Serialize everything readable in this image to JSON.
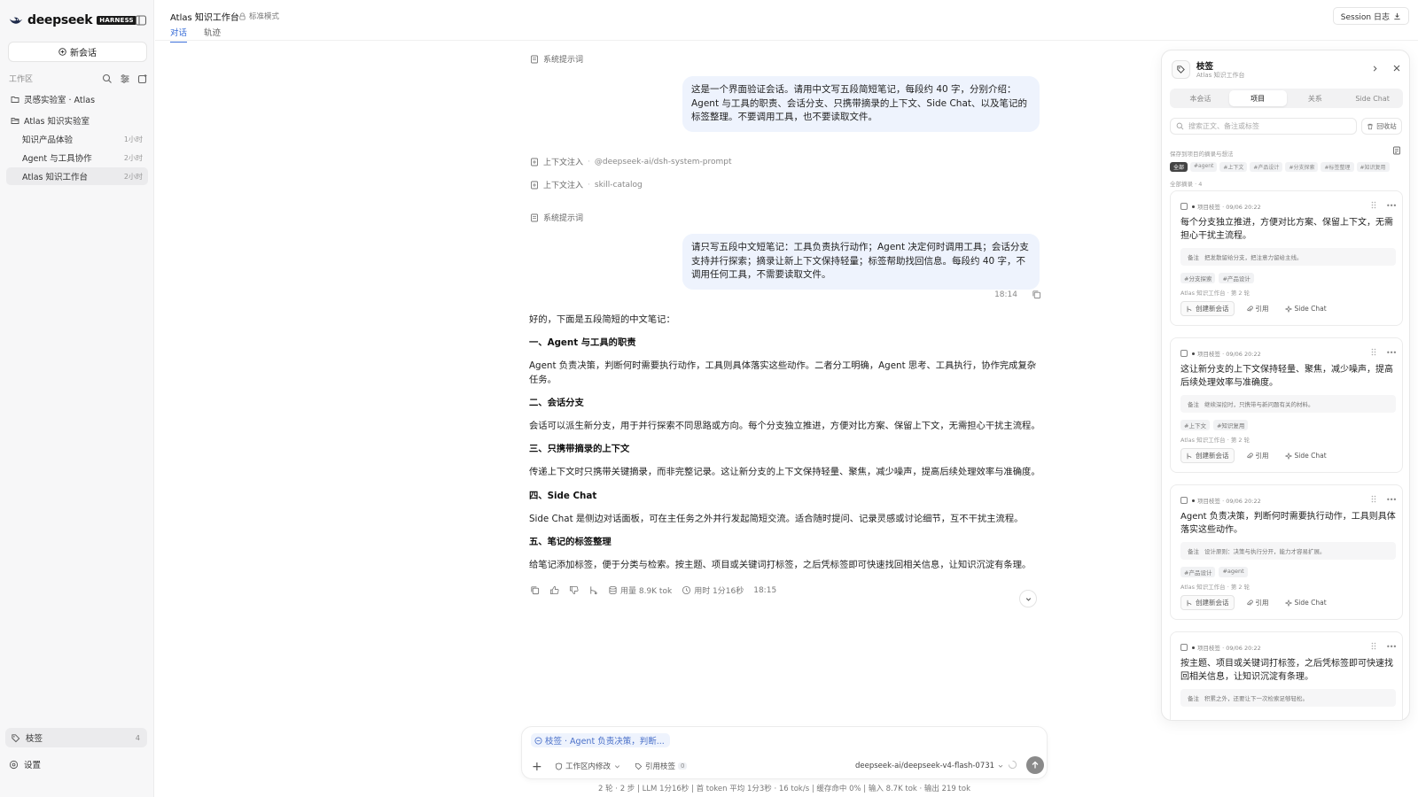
{
  "app": {
    "brand": "deepseek",
    "badge": "HARNESS"
  },
  "sidebar": {
    "new_chat": "新会话",
    "workspace_label": "工作区",
    "folders": [
      "灵感实验室 · Atlas",
      "Atlas 知识实验室"
    ],
    "conversations": [
      {
        "title": "知识产品体验",
        "time": "1小时"
      },
      {
        "title": "Agent 与工具协作",
        "time": "2小时"
      },
      {
        "title": "Atlas 知识工作台",
        "time": "2小时"
      }
    ],
    "tags_nav": {
      "label": "枝签",
      "count": "4"
    },
    "settings": "设置"
  },
  "topbar": {
    "title": "Atlas 知识工作台",
    "mode": "标准模式",
    "tabs": [
      "对话",
      "轨迹"
    ],
    "session_log": "Session 日志"
  },
  "chat": {
    "system_prompt_label": "系统提示词",
    "user_msg_1": "这是一个界面验证会话。请用中文写五段简短笔记，每段约 40 字，分别介绍：Agent 与工具的职责、会话分支、只携带摘录的上下文、Side Chat、以及笔记的标签整理。不要调用工具，也不要读取文件。",
    "context_injections": [
      {
        "label": "上下文注入",
        "value": "@deepseek-ai/dsh-system-prompt"
      },
      {
        "label": "上下文注入",
        "value": "skill-catalog"
      }
    ],
    "user_msg_2": "请只写五段中文短笔记：工具负责执行动作；Agent 决定何时调用工具；会话分支支持并行探索；摘录让新上下文保持轻量；标签帮助找回信息。每段约 40 字，不调用任何工具，不需要读取文件。",
    "user_msg_2_time": "18:14",
    "answer": {
      "intro": "好的，下面是五段简短的中文笔记：",
      "sections": [
        {
          "heading": "一、Agent 与工具的职责",
          "body": "Agent 负责决策，判断何时需要执行动作，工具则具体落实这些动作。二者分工明确，Agent 思考、工具执行，协作完成复杂任务。"
        },
        {
          "heading": "二、会话分支",
          "body": "会话可以派生新分支，用于并行探索不同思路或方向。每个分支独立推进，方便对比方案、保留上下文，无需担心干扰主流程。"
        },
        {
          "heading": "三、只携带摘录的上下文",
          "body": "传递上下文时只携带关键摘录，而非完整记录。这让新分支的上下文保持轻量、聚焦，减少噪声，提高后续处理效率与准确度。"
        },
        {
          "heading": "四、Side Chat",
          "body": "Side Chat 是侧边对话面板，可在主任务之外并行发起简短交流。适合随时提问、记录灵感或讨论细节，互不干扰主流程。"
        },
        {
          "heading": "五、笔记的标签整理",
          "body": "给笔记添加标签，便于分类与检索。按主题、项目或关键词打标签，之后凭标签即可快速找回相关信息，让知识沉淀有条理。"
        }
      ]
    },
    "stats": {
      "usage": "用量 8.9K tok",
      "elapsed": "用时 1分16秒",
      "time": "18:15"
    }
  },
  "composer": {
    "ref_chip": "枝签 · Agent 负责决策，判断...",
    "workspace_btn": "工作区内修改",
    "cite_btn": "引用枝签",
    "cite_count": "0",
    "model": "deepseek-ai/deepseek-v4-flash-0731",
    "status": "2 轮 · 2 步  |  LLM 1分16秒  |  首 token 平均 1分3秒 · 16 tok/s  |  缓存命中 0%  |  输入 8.7K tok · 输出 219 tok"
  },
  "panel": {
    "title": "枝签",
    "subtitle": "Atlas 知识工作台",
    "tabs": [
      "本会话",
      "项目",
      "关系",
      "Side Chat"
    ],
    "search_placeholder": "搜索正文、备注或标签",
    "recycle": "回收站",
    "filter_label": "保存到项目的摘录与想法",
    "filters": [
      "全部",
      "#agent",
      "#上下文",
      "#产品设计",
      "#分支探索",
      "#标签整理",
      "#知识复用"
    ],
    "all_label": "全部摘录 · 4",
    "cards": [
      {
        "meta": "项目枝签 · 09/06 20:22",
        "text": "每个分支独立推进，方便对比方案、保留上下文，无需担心干扰主流程。",
        "note_label": "备注",
        "note": "把发散留给分支，把注意力留给主线。",
        "tags": [
          "#分支探索",
          "#产品设计"
        ],
        "source": "Atlas 知识工作台 · 第 2 轮",
        "create": "创建新会话",
        "cite": "引用",
        "side": "Side Chat"
      },
      {
        "meta": "项目枝签 · 09/06 20:22",
        "text": "这让新分支的上下文保持轻量、聚焦，减少噪声，提高后续处理效率与准确度。",
        "note_label": "备注",
        "note": "继续深挖时，只携带与新问题有关的材料。",
        "tags": [
          "#上下文",
          "#知识复用"
        ],
        "source": "Atlas 知识工作台 · 第 2 轮",
        "create": "创建新会话",
        "cite": "引用",
        "side": "Side Chat"
      },
      {
        "meta": "项目枝签 · 09/06 20:22",
        "text": "Agent 负责决策，判断何时需要执行动作，工具则具体落实这些动作。",
        "note_label": "备注",
        "note": "设计原则：决策与执行分开，能力才容易扩展。",
        "tags": [
          "#产品设计",
          "#agent"
        ],
        "source": "Atlas 知识工作台 · 第 2 轮",
        "create": "创建新会话",
        "cite": "引用",
        "side": "Side Chat"
      },
      {
        "meta": "项目枝签 · 09/06 20:22",
        "text": "按主题、项目或关键词打标签，之后凭标签即可快速找回相关信息，让知识沉淀有条理。",
        "note_label": "备注",
        "note": "积累之外，还要让下一次检索足够轻松。",
        "tags": [],
        "source": "",
        "create": "",
        "cite": "",
        "side": ""
      }
    ]
  },
  "colors": {
    "accent": "#3b6fd8",
    "bubble": "#eef3fd",
    "sidebar_bg": "#f7f7f8"
  }
}
